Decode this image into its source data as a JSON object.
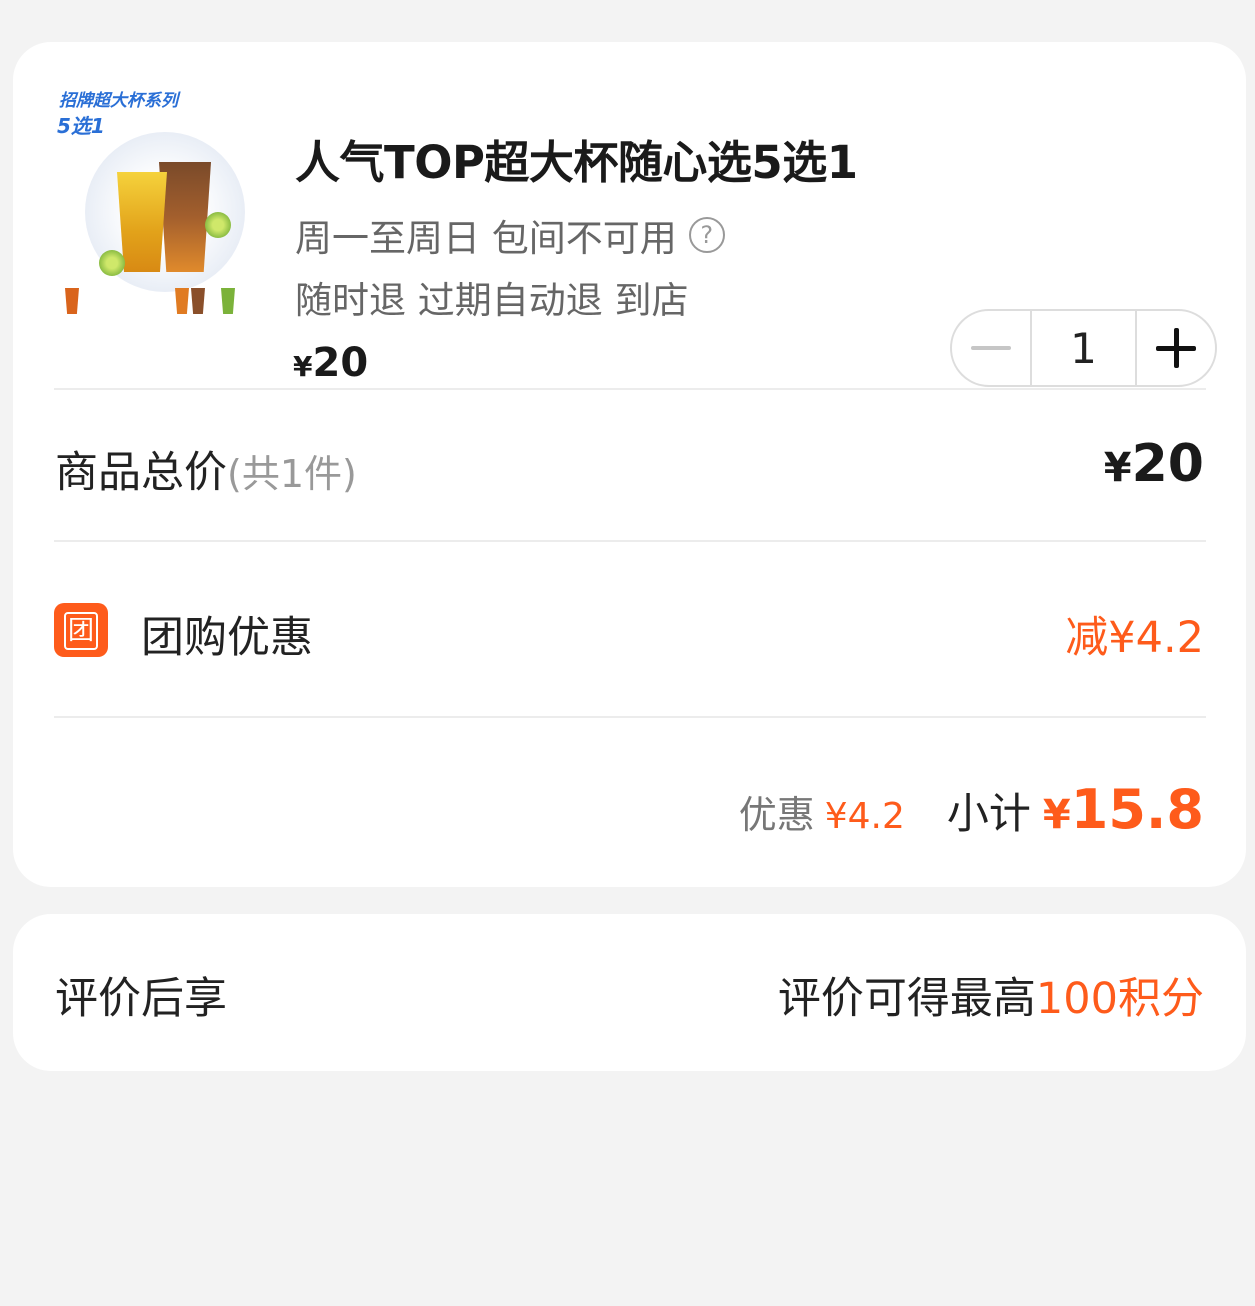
{
  "product": {
    "image_alt": "招牌超大杯系列 5选1",
    "image_text_1": "招牌超大杯系列",
    "image_text_2": "5选1",
    "title": "人气TOP超大杯随心选5选1",
    "usage": "周一至周日 包间不可用",
    "refund": "随时退 过期自动退 到店",
    "currency": "¥",
    "price": "20",
    "help_icon": "question-circle-icon"
  },
  "stepper": {
    "quantity": "1",
    "minus_icon": "minus-icon",
    "plus_icon": "plus-icon"
  },
  "total": {
    "label": "商品总价",
    "count": "(共1件)",
    "currency": "¥",
    "value": "20"
  },
  "group_discount": {
    "icon_char": "团",
    "label": "团购优惠",
    "value": "减¥4.2"
  },
  "summary": {
    "discount_label": "优惠",
    "discount_value": "¥4.2",
    "subtotal_label": "小计",
    "currency": "¥",
    "subtotal_value": "15.8"
  },
  "review": {
    "label": "评价后享",
    "text_prefix": "评价可得最高",
    "text_accent": "100积分"
  },
  "colors": {
    "accent": "#fe5b1b",
    "background": "#f3f3f3",
    "card": "#ffffff"
  }
}
